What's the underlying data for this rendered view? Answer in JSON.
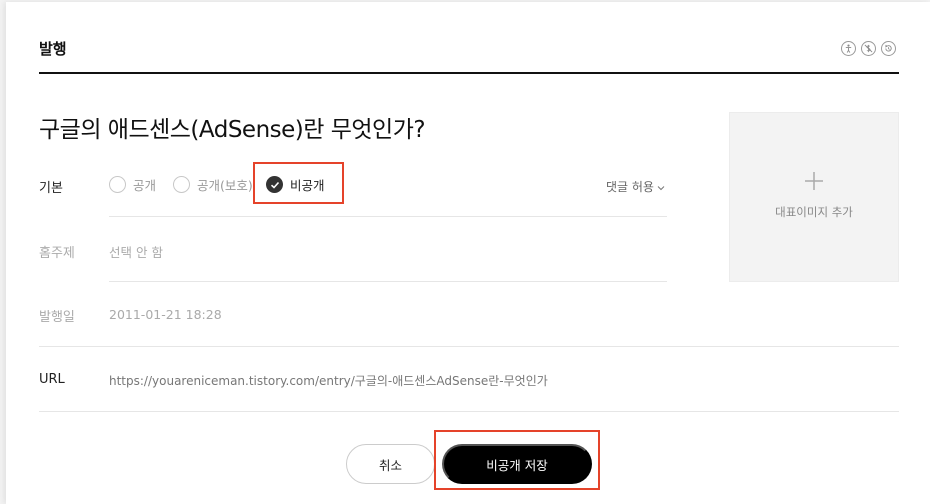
{
  "header": {
    "title": "발행",
    "icons": [
      "accessibility-icon",
      "no-money-icon",
      "history-icon"
    ]
  },
  "post": {
    "title": "구글의 애드센스(AdSense)란 무엇인가?"
  },
  "visibility": {
    "label": "기본",
    "options": [
      {
        "label": "공개",
        "selected": false
      },
      {
        "label": "공개(보호)",
        "selected": false
      },
      {
        "label": "비공개",
        "selected": true
      }
    ],
    "comment_toggle": "댓글 허용"
  },
  "topic": {
    "label": "홈주제",
    "value": "선택 안 함"
  },
  "publish_date": {
    "label": "발행일",
    "value": "2011-01-21 18:28"
  },
  "url": {
    "label": "URL",
    "value": "https://youareniceman.tistory.com/entry/구글의-애드센스AdSense란-무엇인가"
  },
  "thumbnail": {
    "label": "대표이미지 추가"
  },
  "actions": {
    "cancel_label": "취소",
    "save_label": "비공개 저장"
  },
  "colors": {
    "highlight": "#e5432a",
    "primary_button": "#000000"
  }
}
